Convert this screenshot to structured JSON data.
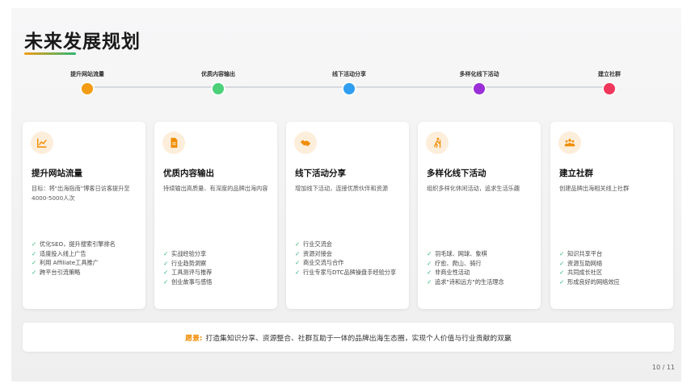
{
  "title": "未来发展规划",
  "colors": {
    "accent_orange": "#f39c12",
    "green": "#2ecc71",
    "blue": "#3498db",
    "purple": "#9b30d9",
    "red": "#f0365a",
    "check_green": "#2bb673"
  },
  "timeline": [
    {
      "label": "提升网站流量",
      "color": "#f39c12"
    },
    {
      "label": "优质内容输出",
      "color": "#4cd07a"
    },
    {
      "label": "线下活动分享",
      "color": "#2f9ef0"
    },
    {
      "label": "多样化线下活动",
      "color": "#9b30d9"
    },
    {
      "label": "建立社群",
      "color": "#f0365a"
    }
  ],
  "cards": [
    {
      "icon": "chart-line-icon",
      "title": "提升网站流量",
      "desc": "目标：将\"出海指南\"博客日访客提升至4000-5000人次",
      "items": [
        "优化SEO，提升搜索引擎排名",
        "适度投入线上广告",
        "利用 Affiliate工具推广",
        "跨平台引流策略"
      ]
    },
    {
      "icon": "document-icon",
      "title": "优质内容输出",
      "desc": "持续输出高质量、有深度的品牌出海内容",
      "items": [
        "实战经验分享",
        "行业趋势洞察",
        "工具测评与推荐",
        "创业故事与感悟"
      ]
    },
    {
      "icon": "handshake-icon",
      "title": "线下活动分享",
      "desc": "增加线下活动，连接优质伙伴和资源",
      "items": [
        "行业交流会",
        "资源对接会",
        "商业交流与合作",
        "行业专家与DTC品牌操盘手经验分享"
      ]
    },
    {
      "icon": "hiking-icon",
      "title": "多样化线下活动",
      "desc": "组织多样化休闲活动，追求生活乐趣",
      "items": [
        "羽毛球、网球、象棋",
        "疗愈、爬山、骑行",
        "非商业性活动",
        "追求\"诗和远方\"的生活理念"
      ]
    },
    {
      "icon": "group-icon",
      "title": "建立社群",
      "desc": "创建品牌出海相关线上社群",
      "items": [
        "知识共享平台",
        "资源互助网络",
        "共同成长社区",
        "形成良好的网络效应"
      ]
    }
  ],
  "vision": {
    "label": "愿景:",
    "text": "打造集知识分享、资源整合、社群互助于一体的品牌出海生态圈，实现个人价值与行业贡献的双赢"
  },
  "page_number": "10 / 11"
}
